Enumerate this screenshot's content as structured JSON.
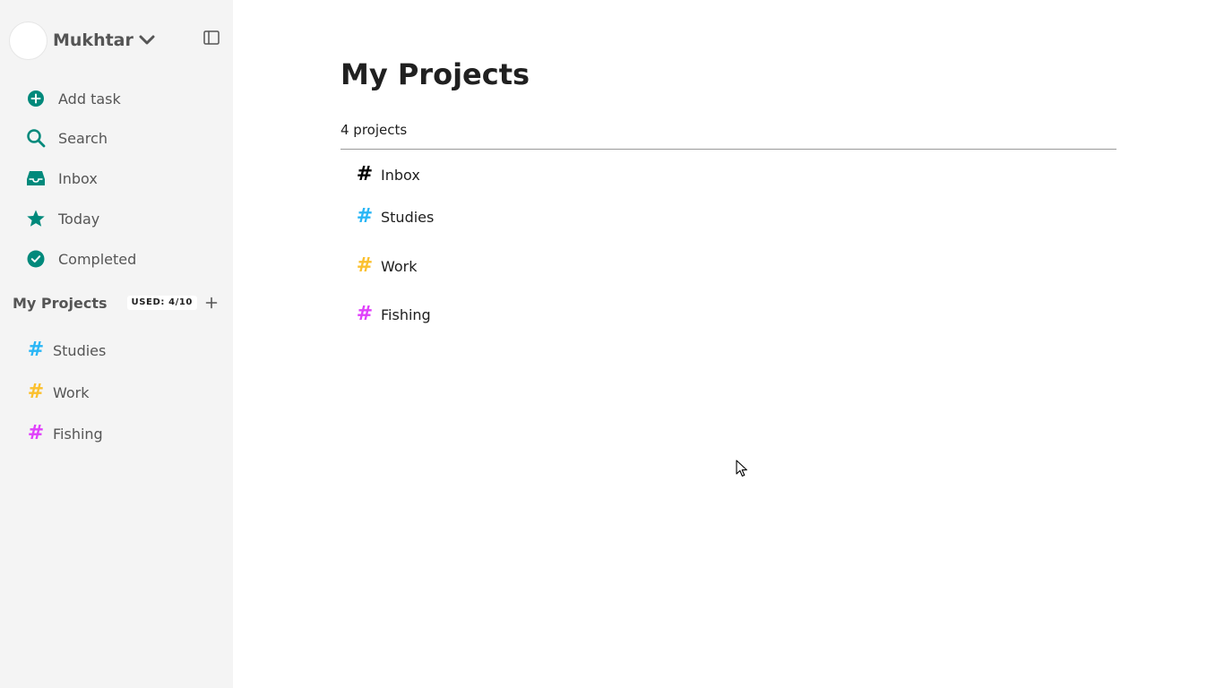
{
  "user": {
    "name": "Mukhtar"
  },
  "nav": [
    {
      "label": "Add task",
      "icon": "plus-circle-icon"
    },
    {
      "label": "Search",
      "icon": "search-icon"
    },
    {
      "label": "Inbox",
      "icon": "inbox-icon"
    },
    {
      "label": "Today",
      "icon": "star-icon"
    },
    {
      "label": "Completed",
      "icon": "check-circle-icon"
    }
  ],
  "sidebar_projects": {
    "title": "My Projects",
    "badge": "USED: 4/10",
    "items": [
      {
        "label": "Studies",
        "color": "#29b6f6"
      },
      {
        "label": "Work",
        "color": "#fbc02d"
      },
      {
        "label": "Fishing",
        "color": "#e040fb"
      }
    ]
  },
  "main": {
    "title": "My Projects",
    "count": "4 projects",
    "items": [
      {
        "label": "Inbox",
        "color": "#000000"
      },
      {
        "label": "Studies",
        "color": "#29b6f6"
      },
      {
        "label": "Work",
        "color": "#fbc02d"
      },
      {
        "label": "Fishing",
        "color": "#e040fb"
      }
    ]
  },
  "colors": {
    "accent": "#00897b",
    "sidebar_bg": "#f4f4f4"
  }
}
